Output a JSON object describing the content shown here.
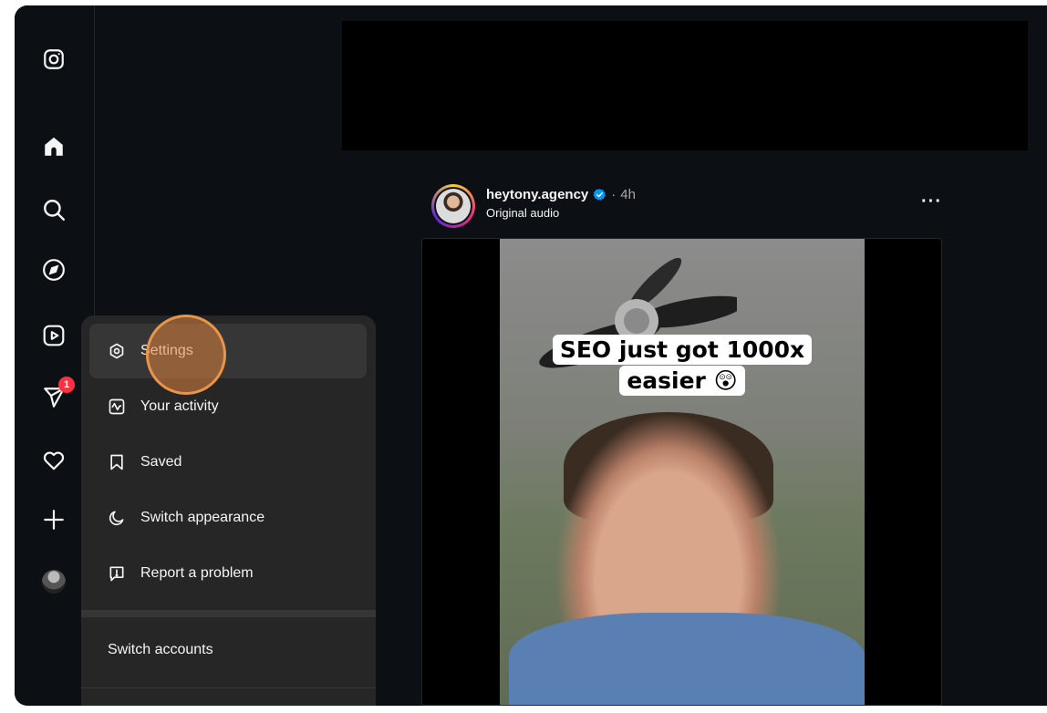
{
  "rail": {
    "items": [
      {
        "name": "instagram-logo-icon"
      },
      {
        "name": "home-icon"
      },
      {
        "name": "search-icon"
      },
      {
        "name": "explore-icon"
      },
      {
        "name": "reels-icon"
      },
      {
        "name": "messages-icon",
        "badge": "1"
      },
      {
        "name": "notifications-icon"
      },
      {
        "name": "create-icon"
      },
      {
        "name": "profile-avatar"
      }
    ]
  },
  "post": {
    "username": "heytony.agency",
    "separator": "·",
    "time": "4h",
    "audio": "Original audio",
    "more_label": "···",
    "caption_line1": "SEO just got 1000x",
    "caption_line2": "easier 😲"
  },
  "menu": {
    "items": [
      {
        "label": "Settings",
        "icon": "gear-icon"
      },
      {
        "label": "Your activity",
        "icon": "activity-icon"
      },
      {
        "label": "Saved",
        "icon": "bookmark-icon"
      },
      {
        "label": "Switch appearance",
        "icon": "moon-icon"
      },
      {
        "label": "Report a problem",
        "icon": "report-icon"
      }
    ],
    "switch_accounts": "Switch accounts"
  },
  "colors": {
    "background": "#0c1014",
    "menu": "#262626",
    "badge": "#ff3040",
    "verified": "#0095f6",
    "click_indicator": "#e8954a"
  }
}
